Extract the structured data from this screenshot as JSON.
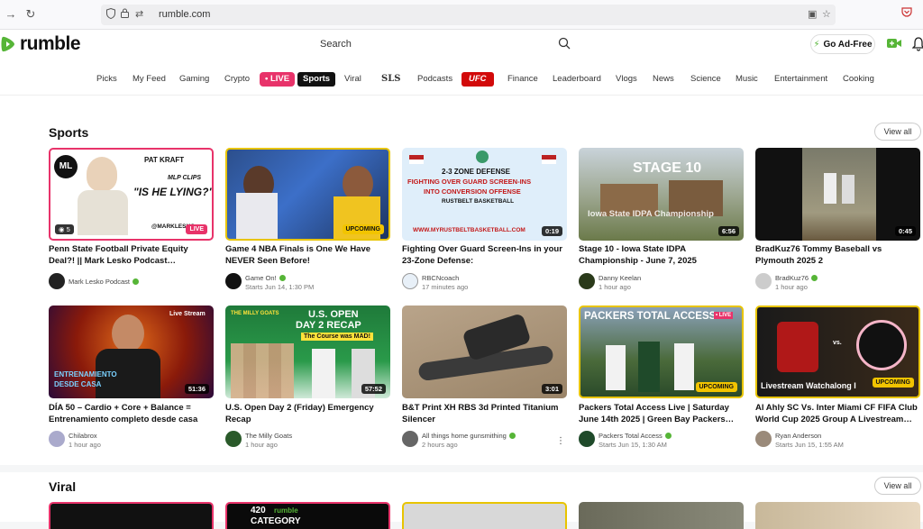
{
  "browser": {
    "url": "rumble.com"
  },
  "header": {
    "logo_text": "rumble",
    "search_label": "Search",
    "ad_free_label": "Go Ad-Free"
  },
  "categories": [
    {
      "label": "Picks"
    },
    {
      "label": "My Feed"
    },
    {
      "label": "Gaming"
    },
    {
      "label": "Crypto"
    },
    {
      "label": "• LIVE"
    },
    {
      "label": "Sports"
    },
    {
      "label": "Viral"
    },
    {
      "label": "SLS"
    },
    {
      "label": "Podcasts"
    },
    {
      "label": "UFC"
    },
    {
      "label": "Finance"
    },
    {
      "label": "Leaderboard"
    },
    {
      "label": "Vlogs"
    },
    {
      "label": "News"
    },
    {
      "label": "Science"
    },
    {
      "label": "Music"
    },
    {
      "label": "Entertainment"
    },
    {
      "label": "Cooking"
    }
  ],
  "sports": {
    "title": "Sports",
    "view_all": "View all",
    "cards": [
      {
        "title": "Penn State Football Private Equity Deal?! || Mark Lesko Podcast…",
        "channel": "Mark Lesko Podcast",
        "meta": "",
        "views": "5",
        "badge": "LIVE",
        "thumb_lines": [
          "PAT KRAFT",
          "MLP CLIPS",
          "\"IS HE LYING?\"",
          "@MARKLESKO"
        ]
      },
      {
        "title": "Game 4 NBA Finals is One We Have NEVER Seen Before!",
        "channel": "Game On!",
        "meta": "Starts Jun 14, 1:30 PM",
        "badge": "UPCOMING",
        "thumb_lines": []
      },
      {
        "title": "Fighting Over Guard Screen-Ins in your 23-Zone Defense:",
        "channel": "RBCNcoach",
        "meta": "17 minutes ago",
        "duration": "0:19",
        "thumb_lines": [
          "2-3 ZONE DEFENSE",
          "FIGHTING OVER GUARD SCREEN-INS",
          "INTO CONVERSION OFFENSE",
          "RUSTBELT BASKETBALL",
          "WWW.MYRUSTBELTBASKETBALL.COM"
        ]
      },
      {
        "title": "Stage 10 - Iowa State IDPA Championship - June 7, 2025",
        "channel": "Danny Keelan",
        "meta": "1 hour ago",
        "duration": "6:56",
        "thumb_lines": [
          "STAGE 10",
          "Iowa State IDPA Championship"
        ]
      },
      {
        "title": "BradKuz76 Tommy Baseball vs Plymouth 2025 2",
        "channel": "BradKuz76",
        "meta": "1 hour ago",
        "duration": "0:45",
        "thumb_lines": []
      }
    ]
  },
  "row2": {
    "cards": [
      {
        "title": "DÍA 50 – Cardio + Core + Balance = Entrenamiento completo desde casa",
        "channel": "Chilabrox",
        "meta": "1 hour ago",
        "duration": "51:36",
        "thumb_lines": [
          "ENTRENAMIENTO",
          "DESDE CASA",
          "Live Stream"
        ]
      },
      {
        "title": "U.S. Open Day 2 (Friday) Emergency Recap",
        "channel": "The Milly Goats",
        "meta": "1 hour ago",
        "duration": "57:52",
        "thumb_lines": [
          "U.S. OPEN",
          "DAY 2 RECAP",
          "The Course was MAD!",
          "THE MILLY GOATS"
        ]
      },
      {
        "title": "B&T Print XH RBS 3d Printed Titanium Silencer",
        "channel": "All things home gunsmithing",
        "meta": "2 hours ago",
        "duration": "3:01",
        "thumb_lines": []
      },
      {
        "title": "Packers Total Access Live | Saturday June 14th 2025 | Green Bay Packers…",
        "channel": "Packers Total Access",
        "meta": "Starts Jun 15, 1:30 AM",
        "badge": "UPCOMING",
        "thumb_lines": [
          "PACKERS TOTAL ACCESS",
          "• LIVE"
        ]
      },
      {
        "title": "Al Ahly SC Vs. Inter Miami CF FIFA Club World Cup 2025 Group A Livestream…",
        "channel": "Ryan Anderson",
        "meta": "Starts Jun 15, 1:55 AM",
        "badge": "UPCOMING",
        "thumb_lines": [
          "Livestream Watchalong I"
        ]
      }
    ]
  },
  "viral": {
    "title": "Viral",
    "view_all": "View all",
    "thumb_lines": [
      "420",
      "rumble",
      "CATEGORY"
    ]
  },
  "colors": {
    "brand_green": "#56b537",
    "live_pink": "#e8336a",
    "ufc_red": "#d20a0a",
    "upcoming_yellow": "#f2c400"
  }
}
